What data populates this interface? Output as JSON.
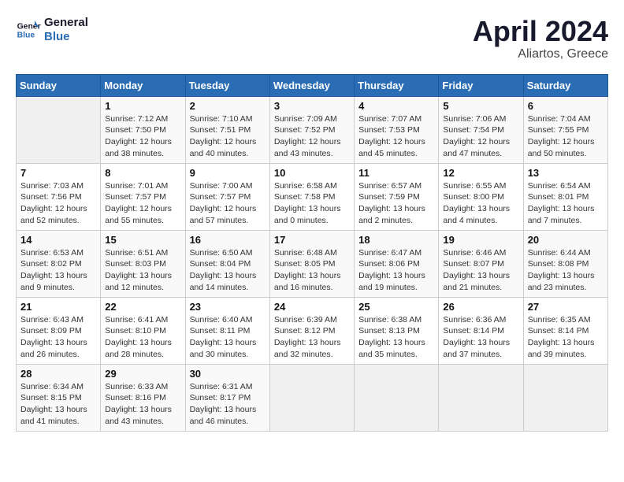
{
  "header": {
    "logo_line1": "General",
    "logo_line2": "Blue",
    "month_title": "April 2024",
    "location": "Aliartos, Greece"
  },
  "weekdays": [
    "Sunday",
    "Monday",
    "Tuesday",
    "Wednesday",
    "Thursday",
    "Friday",
    "Saturday"
  ],
  "weeks": [
    [
      {
        "day": "",
        "info": ""
      },
      {
        "day": "1",
        "info": "Sunrise: 7:12 AM\nSunset: 7:50 PM\nDaylight: 12 hours\nand 38 minutes."
      },
      {
        "day": "2",
        "info": "Sunrise: 7:10 AM\nSunset: 7:51 PM\nDaylight: 12 hours\nand 40 minutes."
      },
      {
        "day": "3",
        "info": "Sunrise: 7:09 AM\nSunset: 7:52 PM\nDaylight: 12 hours\nand 43 minutes."
      },
      {
        "day": "4",
        "info": "Sunrise: 7:07 AM\nSunset: 7:53 PM\nDaylight: 12 hours\nand 45 minutes."
      },
      {
        "day": "5",
        "info": "Sunrise: 7:06 AM\nSunset: 7:54 PM\nDaylight: 12 hours\nand 47 minutes."
      },
      {
        "day": "6",
        "info": "Sunrise: 7:04 AM\nSunset: 7:55 PM\nDaylight: 12 hours\nand 50 minutes."
      }
    ],
    [
      {
        "day": "7",
        "info": "Sunrise: 7:03 AM\nSunset: 7:56 PM\nDaylight: 12 hours\nand 52 minutes."
      },
      {
        "day": "8",
        "info": "Sunrise: 7:01 AM\nSunset: 7:57 PM\nDaylight: 12 hours\nand 55 minutes."
      },
      {
        "day": "9",
        "info": "Sunrise: 7:00 AM\nSunset: 7:57 PM\nDaylight: 12 hours\nand 57 minutes."
      },
      {
        "day": "10",
        "info": "Sunrise: 6:58 AM\nSunset: 7:58 PM\nDaylight: 13 hours\nand 0 minutes."
      },
      {
        "day": "11",
        "info": "Sunrise: 6:57 AM\nSunset: 7:59 PM\nDaylight: 13 hours\nand 2 minutes."
      },
      {
        "day": "12",
        "info": "Sunrise: 6:55 AM\nSunset: 8:00 PM\nDaylight: 13 hours\nand 4 minutes."
      },
      {
        "day": "13",
        "info": "Sunrise: 6:54 AM\nSunset: 8:01 PM\nDaylight: 13 hours\nand 7 minutes."
      }
    ],
    [
      {
        "day": "14",
        "info": "Sunrise: 6:53 AM\nSunset: 8:02 PM\nDaylight: 13 hours\nand 9 minutes."
      },
      {
        "day": "15",
        "info": "Sunrise: 6:51 AM\nSunset: 8:03 PM\nDaylight: 13 hours\nand 12 minutes."
      },
      {
        "day": "16",
        "info": "Sunrise: 6:50 AM\nSunset: 8:04 PM\nDaylight: 13 hours\nand 14 minutes."
      },
      {
        "day": "17",
        "info": "Sunrise: 6:48 AM\nSunset: 8:05 PM\nDaylight: 13 hours\nand 16 minutes."
      },
      {
        "day": "18",
        "info": "Sunrise: 6:47 AM\nSunset: 8:06 PM\nDaylight: 13 hours\nand 19 minutes."
      },
      {
        "day": "19",
        "info": "Sunrise: 6:46 AM\nSunset: 8:07 PM\nDaylight: 13 hours\nand 21 minutes."
      },
      {
        "day": "20",
        "info": "Sunrise: 6:44 AM\nSunset: 8:08 PM\nDaylight: 13 hours\nand 23 minutes."
      }
    ],
    [
      {
        "day": "21",
        "info": "Sunrise: 6:43 AM\nSunset: 8:09 PM\nDaylight: 13 hours\nand 26 minutes."
      },
      {
        "day": "22",
        "info": "Sunrise: 6:41 AM\nSunset: 8:10 PM\nDaylight: 13 hours\nand 28 minutes."
      },
      {
        "day": "23",
        "info": "Sunrise: 6:40 AM\nSunset: 8:11 PM\nDaylight: 13 hours\nand 30 minutes."
      },
      {
        "day": "24",
        "info": "Sunrise: 6:39 AM\nSunset: 8:12 PM\nDaylight: 13 hours\nand 32 minutes."
      },
      {
        "day": "25",
        "info": "Sunrise: 6:38 AM\nSunset: 8:13 PM\nDaylight: 13 hours\nand 35 minutes."
      },
      {
        "day": "26",
        "info": "Sunrise: 6:36 AM\nSunset: 8:14 PM\nDaylight: 13 hours\nand 37 minutes."
      },
      {
        "day": "27",
        "info": "Sunrise: 6:35 AM\nSunset: 8:14 PM\nDaylight: 13 hours\nand 39 minutes."
      }
    ],
    [
      {
        "day": "28",
        "info": "Sunrise: 6:34 AM\nSunset: 8:15 PM\nDaylight: 13 hours\nand 41 minutes."
      },
      {
        "day": "29",
        "info": "Sunrise: 6:33 AM\nSunset: 8:16 PM\nDaylight: 13 hours\nand 43 minutes."
      },
      {
        "day": "30",
        "info": "Sunrise: 6:31 AM\nSunset: 8:17 PM\nDaylight: 13 hours\nand 46 minutes."
      },
      {
        "day": "",
        "info": ""
      },
      {
        "day": "",
        "info": ""
      },
      {
        "day": "",
        "info": ""
      },
      {
        "day": "",
        "info": ""
      }
    ]
  ]
}
